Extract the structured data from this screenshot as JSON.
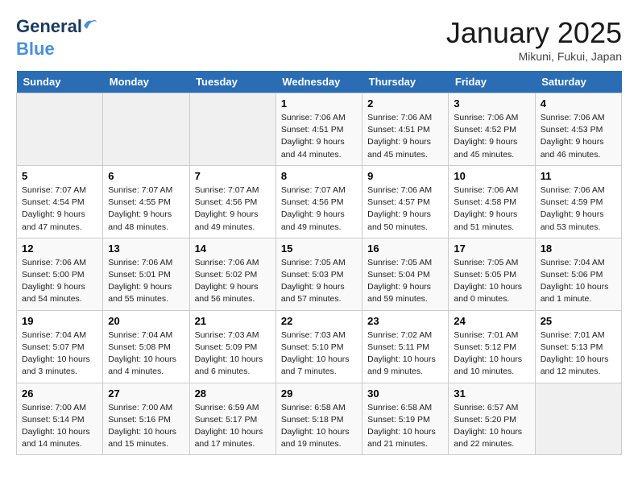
{
  "header": {
    "logo_line1": "General",
    "logo_line2": "Blue",
    "month": "January 2025",
    "location": "Mikuni, Fukui, Japan"
  },
  "weekdays": [
    "Sunday",
    "Monday",
    "Tuesday",
    "Wednesday",
    "Thursday",
    "Friday",
    "Saturday"
  ],
  "weeks": [
    [
      {
        "day": null
      },
      {
        "day": null
      },
      {
        "day": null
      },
      {
        "day": "1",
        "sunrise": "7:06 AM",
        "sunset": "4:51 PM",
        "daylight": "9 hours and 44 minutes."
      },
      {
        "day": "2",
        "sunrise": "7:06 AM",
        "sunset": "4:51 PM",
        "daylight": "9 hours and 45 minutes."
      },
      {
        "day": "3",
        "sunrise": "7:06 AM",
        "sunset": "4:52 PM",
        "daylight": "9 hours and 45 minutes."
      },
      {
        "day": "4",
        "sunrise": "7:06 AM",
        "sunset": "4:53 PM",
        "daylight": "9 hours and 46 minutes."
      }
    ],
    [
      {
        "day": "5",
        "sunrise": "7:07 AM",
        "sunset": "4:54 PM",
        "daylight": "9 hours and 47 minutes."
      },
      {
        "day": "6",
        "sunrise": "7:07 AM",
        "sunset": "4:55 PM",
        "daylight": "9 hours and 48 minutes."
      },
      {
        "day": "7",
        "sunrise": "7:07 AM",
        "sunset": "4:56 PM",
        "daylight": "9 hours and 49 minutes."
      },
      {
        "day": "8",
        "sunrise": "7:07 AM",
        "sunset": "4:56 PM",
        "daylight": "9 hours and 49 minutes."
      },
      {
        "day": "9",
        "sunrise": "7:06 AM",
        "sunset": "4:57 PM",
        "daylight": "9 hours and 50 minutes."
      },
      {
        "day": "10",
        "sunrise": "7:06 AM",
        "sunset": "4:58 PM",
        "daylight": "9 hours and 51 minutes."
      },
      {
        "day": "11",
        "sunrise": "7:06 AM",
        "sunset": "4:59 PM",
        "daylight": "9 hours and 53 minutes."
      }
    ],
    [
      {
        "day": "12",
        "sunrise": "7:06 AM",
        "sunset": "5:00 PM",
        "daylight": "9 hours and 54 minutes."
      },
      {
        "day": "13",
        "sunrise": "7:06 AM",
        "sunset": "5:01 PM",
        "daylight": "9 hours and 55 minutes."
      },
      {
        "day": "14",
        "sunrise": "7:06 AM",
        "sunset": "5:02 PM",
        "daylight": "9 hours and 56 minutes."
      },
      {
        "day": "15",
        "sunrise": "7:05 AM",
        "sunset": "5:03 PM",
        "daylight": "9 hours and 57 minutes."
      },
      {
        "day": "16",
        "sunrise": "7:05 AM",
        "sunset": "5:04 PM",
        "daylight": "9 hours and 59 minutes."
      },
      {
        "day": "17",
        "sunrise": "7:05 AM",
        "sunset": "5:05 PM",
        "daylight": "10 hours and 0 minutes."
      },
      {
        "day": "18",
        "sunrise": "7:04 AM",
        "sunset": "5:06 PM",
        "daylight": "10 hours and 1 minute."
      }
    ],
    [
      {
        "day": "19",
        "sunrise": "7:04 AM",
        "sunset": "5:07 PM",
        "daylight": "10 hours and 3 minutes."
      },
      {
        "day": "20",
        "sunrise": "7:04 AM",
        "sunset": "5:08 PM",
        "daylight": "10 hours and 4 minutes."
      },
      {
        "day": "21",
        "sunrise": "7:03 AM",
        "sunset": "5:09 PM",
        "daylight": "10 hours and 6 minutes."
      },
      {
        "day": "22",
        "sunrise": "7:03 AM",
        "sunset": "5:10 PM",
        "daylight": "10 hours and 7 minutes."
      },
      {
        "day": "23",
        "sunrise": "7:02 AM",
        "sunset": "5:11 PM",
        "daylight": "10 hours and 9 minutes."
      },
      {
        "day": "24",
        "sunrise": "7:01 AM",
        "sunset": "5:12 PM",
        "daylight": "10 hours and 10 minutes."
      },
      {
        "day": "25",
        "sunrise": "7:01 AM",
        "sunset": "5:13 PM",
        "daylight": "10 hours and 12 minutes."
      }
    ],
    [
      {
        "day": "26",
        "sunrise": "7:00 AM",
        "sunset": "5:14 PM",
        "daylight": "10 hours and 14 minutes."
      },
      {
        "day": "27",
        "sunrise": "7:00 AM",
        "sunset": "5:16 PM",
        "daylight": "10 hours and 15 minutes."
      },
      {
        "day": "28",
        "sunrise": "6:59 AM",
        "sunset": "5:17 PM",
        "daylight": "10 hours and 17 minutes."
      },
      {
        "day": "29",
        "sunrise": "6:58 AM",
        "sunset": "5:18 PM",
        "daylight": "10 hours and 19 minutes."
      },
      {
        "day": "30",
        "sunrise": "6:58 AM",
        "sunset": "5:19 PM",
        "daylight": "10 hours and 21 minutes."
      },
      {
        "day": "31",
        "sunrise": "6:57 AM",
        "sunset": "5:20 PM",
        "daylight": "10 hours and 22 minutes."
      },
      {
        "day": null
      }
    ]
  ]
}
